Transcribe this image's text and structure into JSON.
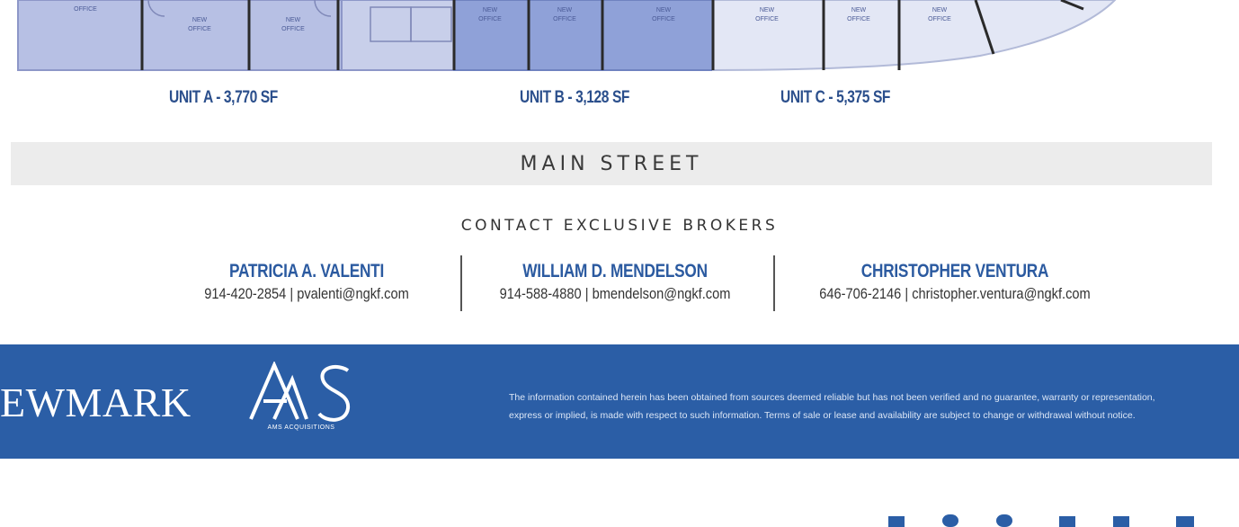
{
  "floor_plan": {
    "room_label_line1": "NEW",
    "room_label_line2": "OFFICE",
    "units": [
      {
        "label": "UNIT A - 3,770 SF"
      },
      {
        "label": "UNIT B - 3,128 SF"
      },
      {
        "label": "UNIT C - 5,375 SF"
      }
    ],
    "colors": {
      "unit_a": "#b7c0e4",
      "unit_b": "#8fa1d8",
      "unit_c": "#e3e7f5",
      "walls": "#2a2a2a"
    }
  },
  "street": {
    "name": "MAIN STREET"
  },
  "contact": {
    "heading": "CONTACT EXCLUSIVE BROKERS",
    "brokers": [
      {
        "name": "PATRICIA A. VALENTI",
        "contact": "914-420-2854 | pvalenti@ngkf.com"
      },
      {
        "name": "WILLIAM D. MENDELSON",
        "contact": "914-588-4880 | bmendelson@ngkf.com"
      },
      {
        "name": "CHRISTOPHER VENTURA",
        "contact": "646-706-2146 | christopher.ventura@ngkf.com"
      }
    ]
  },
  "footer": {
    "brand": "EWMARK",
    "logo_sub": "AMS ACQUISITIONS",
    "disclaimer_line1": "The information contained herein has been obtained from sources deemed reliable but has not been verified and no guarantee, warranty or representation,",
    "disclaimer_line2": "express or implied, is made with respect to such information. Terms of sale or lease and availability are subject to change or withdrawal without notice.",
    "background": "#2b5ea6"
  }
}
